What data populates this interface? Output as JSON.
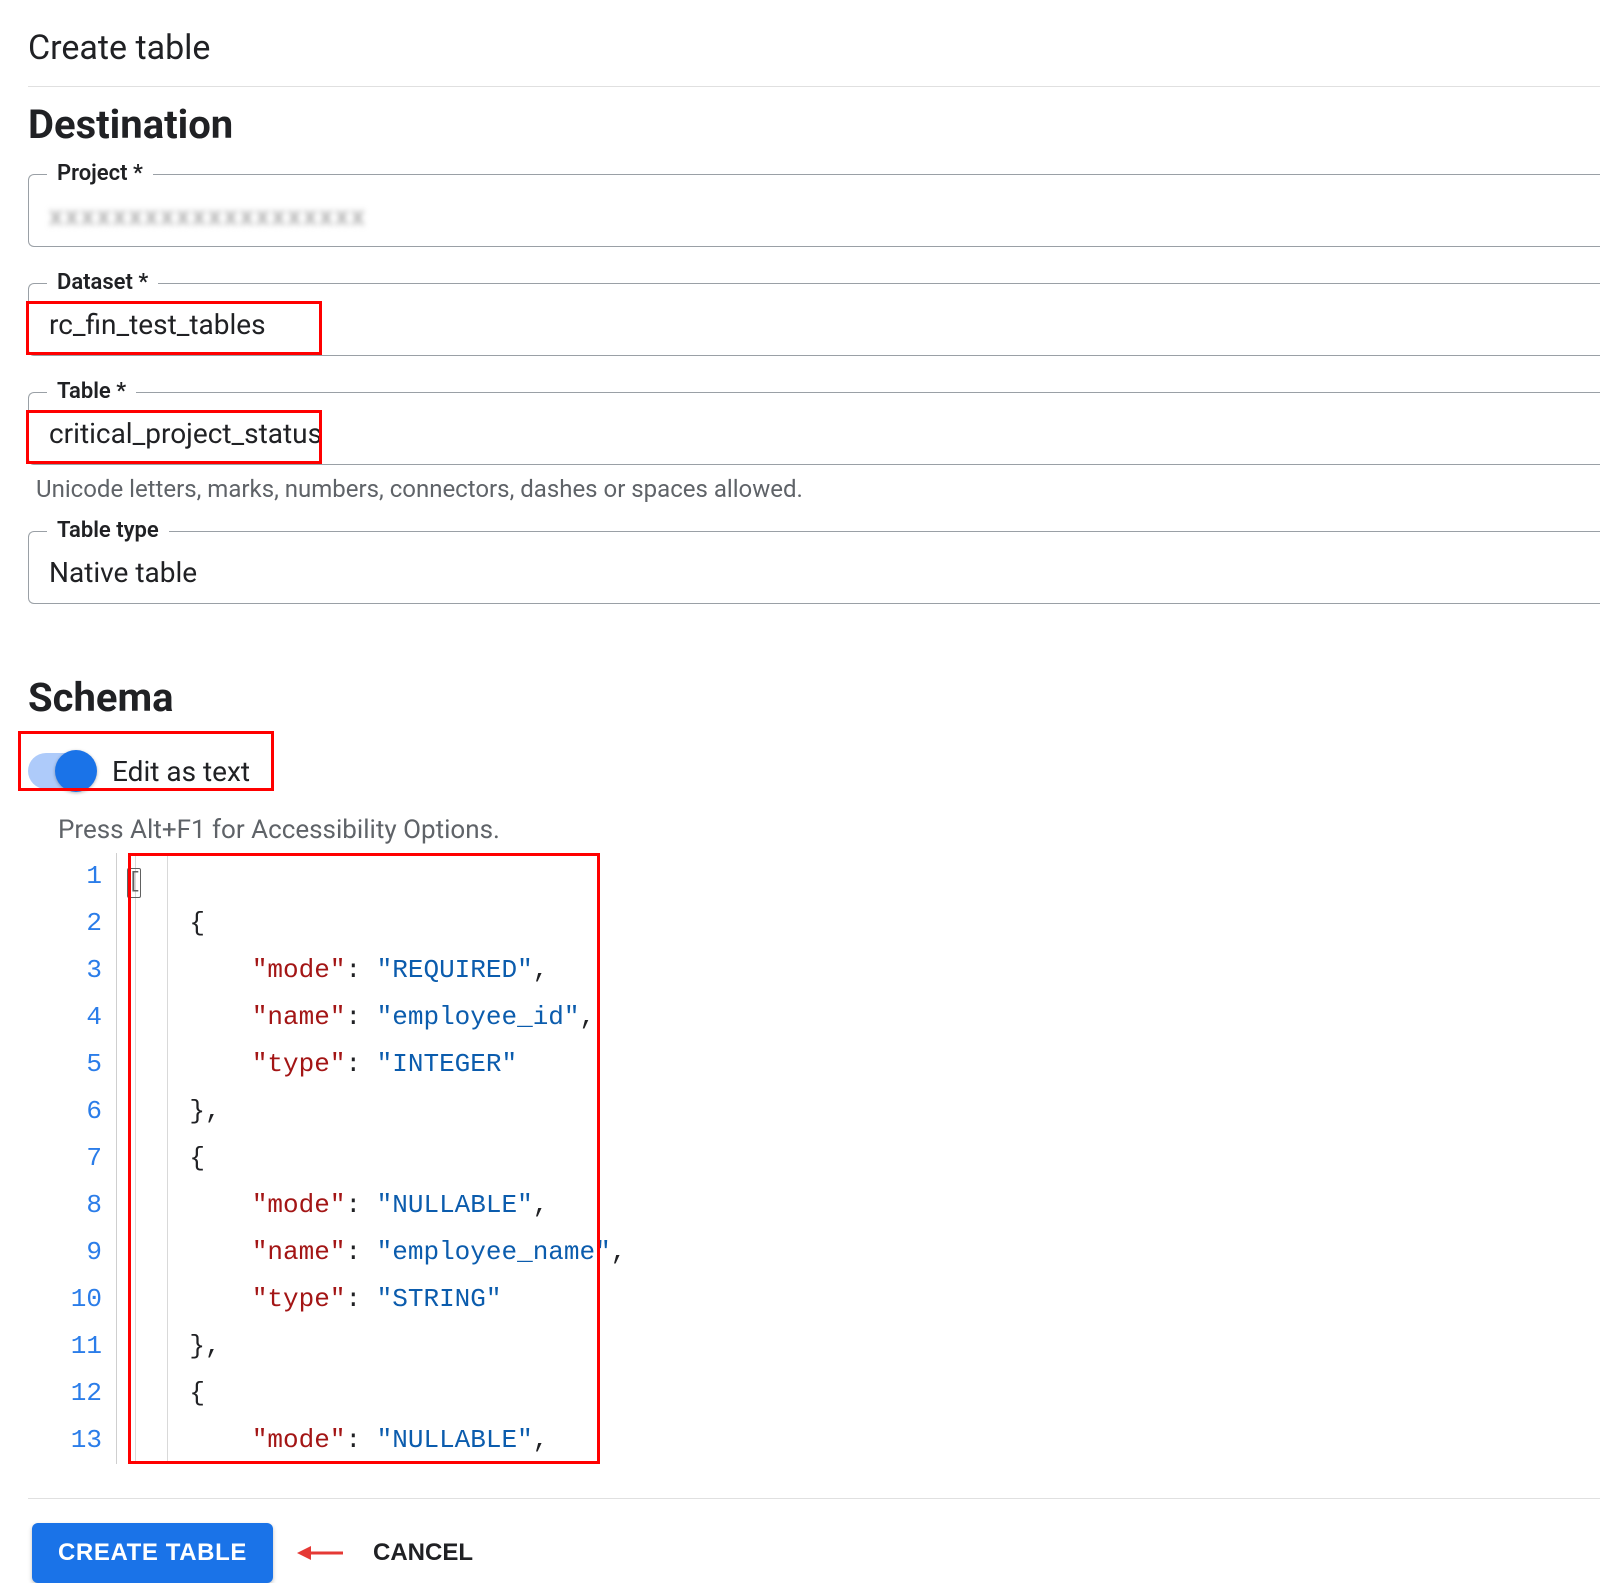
{
  "header": {
    "title": "Create table"
  },
  "destination": {
    "heading": "Destination",
    "project": {
      "label": "Project *",
      "value": "xxxxxxxxxxxxxxxxxxxx"
    },
    "dataset": {
      "label": "Dataset *",
      "value": "rc_fin_test_tables"
    },
    "table": {
      "label": "Table *",
      "value": "critical_project_status",
      "helper": "Unicode letters, marks, numbers, connectors, dashes or spaces allowed."
    },
    "table_type": {
      "label": "Table type",
      "value": "Native table"
    }
  },
  "schema": {
    "heading": "Schema",
    "toggle_label": "Edit as text",
    "toggle_on": true,
    "a11y_hint": "Press Alt+F1 for Accessibility Options.",
    "line_numbers": [
      "1",
      "2",
      "3",
      "4",
      "5",
      "6",
      "7",
      "8",
      "9",
      "10",
      "11",
      "12",
      "13"
    ],
    "code_tokens": [
      [
        {
          "txt": "[",
          "cls": "punc",
          "caret": true
        }
      ],
      [
        {
          "txt": "    {",
          "cls": "punc"
        }
      ],
      [
        {
          "txt": "        ",
          "cls": "punc"
        },
        {
          "txt": "\"mode\"",
          "cls": "key"
        },
        {
          "txt": ": ",
          "cls": "colon"
        },
        {
          "txt": "\"REQUIRED\"",
          "cls": "str"
        },
        {
          "txt": ",",
          "cls": "punc"
        }
      ],
      [
        {
          "txt": "        ",
          "cls": "punc"
        },
        {
          "txt": "\"name\"",
          "cls": "key"
        },
        {
          "txt": ": ",
          "cls": "colon"
        },
        {
          "txt": "\"employee_id\"",
          "cls": "str"
        },
        {
          "txt": ",",
          "cls": "punc"
        }
      ],
      [
        {
          "txt": "        ",
          "cls": "punc"
        },
        {
          "txt": "\"type\"",
          "cls": "key"
        },
        {
          "txt": ": ",
          "cls": "colon"
        },
        {
          "txt": "\"INTEGER\"",
          "cls": "str"
        }
      ],
      [
        {
          "txt": "    },",
          "cls": "punc"
        }
      ],
      [
        {
          "txt": "    {",
          "cls": "punc"
        }
      ],
      [
        {
          "txt": "        ",
          "cls": "punc"
        },
        {
          "txt": "\"mode\"",
          "cls": "key"
        },
        {
          "txt": ": ",
          "cls": "colon"
        },
        {
          "txt": "\"NULLABLE\"",
          "cls": "str"
        },
        {
          "txt": ",",
          "cls": "punc"
        }
      ],
      [
        {
          "txt": "        ",
          "cls": "punc"
        },
        {
          "txt": "\"name\"",
          "cls": "key"
        },
        {
          "txt": ": ",
          "cls": "colon"
        },
        {
          "txt": "\"employee_name\"",
          "cls": "str"
        },
        {
          "txt": ",",
          "cls": "punc"
        }
      ],
      [
        {
          "txt": "        ",
          "cls": "punc"
        },
        {
          "txt": "\"type\"",
          "cls": "key"
        },
        {
          "txt": ": ",
          "cls": "colon"
        },
        {
          "txt": "\"STRING\"",
          "cls": "str"
        }
      ],
      [
        {
          "txt": "    },",
          "cls": "punc"
        }
      ],
      [
        {
          "txt": "    {",
          "cls": "punc"
        }
      ],
      [
        {
          "txt": "        ",
          "cls": "punc"
        },
        {
          "txt": "\"mode\"",
          "cls": "key"
        },
        {
          "txt": ": ",
          "cls": "colon"
        },
        {
          "txt": "\"NULLABLE\"",
          "cls": "str"
        },
        {
          "txt": ",",
          "cls": "punc"
        }
      ]
    ]
  },
  "footer": {
    "create_label": "CREATE TABLE",
    "cancel_label": "CANCEL"
  }
}
